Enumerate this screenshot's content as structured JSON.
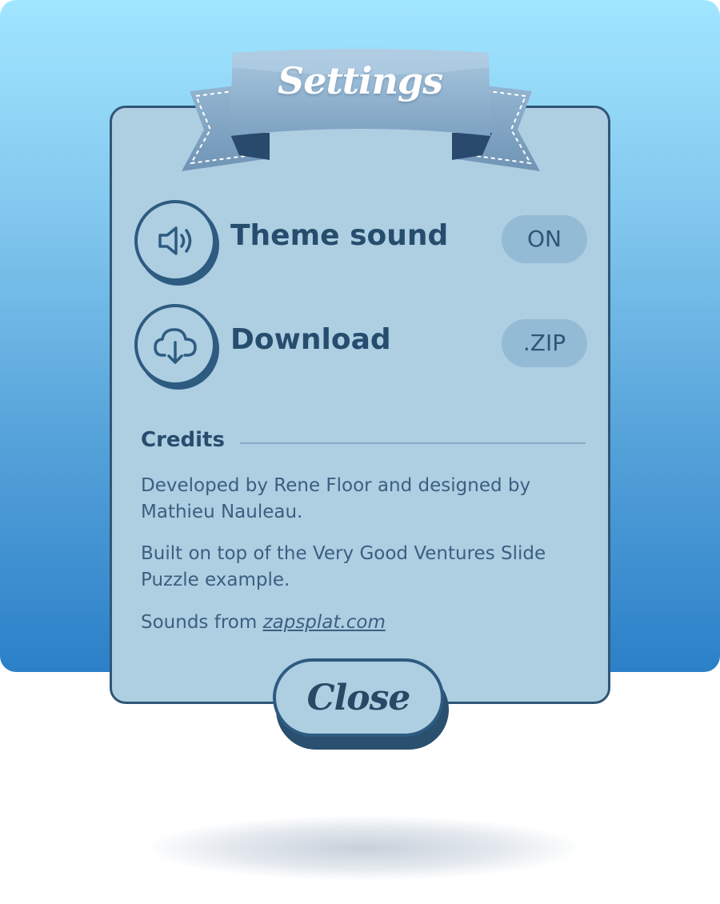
{
  "dialog": {
    "title": "Settings"
  },
  "settings": {
    "items": [
      {
        "icon": "speaker-volume-icon",
        "label": "Theme sound",
        "value": "ON"
      },
      {
        "icon": "cloud-download-icon",
        "label": "Download",
        "value": ".ZIP"
      }
    ]
  },
  "credits": {
    "heading": "Credits",
    "paragraphs": [
      "Developed by Rene Floor and designed by Mathieu Nauleau.",
      "Built on top of the Very Good Ventures Slide Puzzle example."
    ],
    "sounds_prefix": "Sounds from ",
    "sounds_link": "zapsplat.com"
  },
  "close_button": {
    "label": "Close"
  },
  "colors": {
    "sky_top": "#a1e6ff",
    "sky_bottom": "#2b80c8",
    "panel": "#aecee2",
    "border": "#2f5676",
    "ribbon": "#8fb3d1",
    "text_dark": "#274d6e"
  }
}
